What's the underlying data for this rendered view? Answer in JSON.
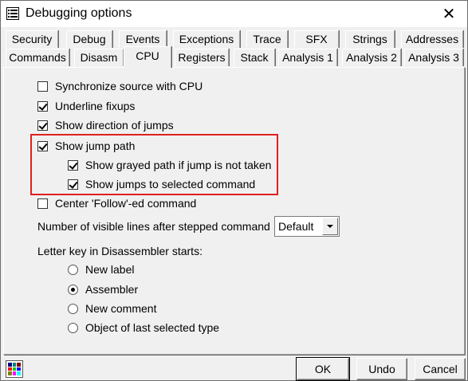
{
  "window": {
    "title": "Debugging options",
    "close_glyph": "✕"
  },
  "tabs_row1": [
    "Security",
    "Debug",
    "Events",
    "Exceptions",
    "Trace",
    "SFX",
    "Strings",
    "Addresses"
  ],
  "tabs_row2": [
    "Commands",
    "Disasm",
    "CPU",
    "Registers",
    "Stack",
    "Analysis 1",
    "Analysis 2",
    "Analysis 3"
  ],
  "active_tab": "CPU",
  "options": {
    "sync_source": {
      "label": "Synchronize source with CPU",
      "checked": false
    },
    "underline_fixups": {
      "label": "Underline fixups",
      "checked": true
    },
    "show_direction": {
      "label": "Show direction of jumps",
      "checked": true
    },
    "show_jump_path": {
      "label": "Show jump path",
      "checked": true
    },
    "show_grayed_path": {
      "label": "Show grayed path if jump is not taken",
      "checked": true
    },
    "show_jumps_selected": {
      "label": "Show jumps to selected command",
      "checked": true
    },
    "center_follow": {
      "label": "Center 'Follow'-ed command",
      "checked": false
    }
  },
  "visible_lines": {
    "label": "Number of visible lines after stepped command",
    "value": "Default"
  },
  "letter_key": {
    "label": "Letter key in Disassembler starts:",
    "options": [
      {
        "label": "New label",
        "checked": false
      },
      {
        "label": "Assembler",
        "checked": true
      },
      {
        "label": "New comment",
        "checked": false
      },
      {
        "label": "Object of last selected type",
        "checked": false
      }
    ]
  },
  "buttons": {
    "ok": "OK",
    "undo": "Undo",
    "cancel": "Cancel"
  },
  "colors": {
    "highlight": "#e02020"
  },
  "icons": {
    "title": "options-list-icon",
    "palette": "color-palette-icon"
  }
}
